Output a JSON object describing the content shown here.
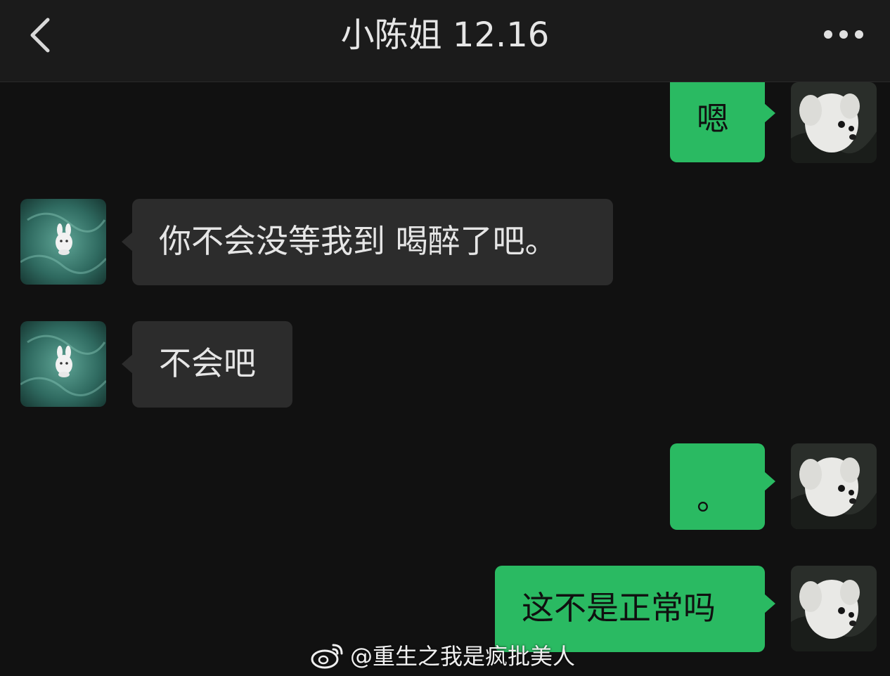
{
  "header": {
    "title": "小陈姐 12.16"
  },
  "icons": {
    "back": "chevron-left-icon",
    "more": "ellipsis-icon",
    "watermark_logo": "weibo-icon"
  },
  "messages": [
    {
      "side": "out",
      "text": "嗯"
    },
    {
      "side": "in",
      "text": "你不会没等我到 喝醉了吧。"
    },
    {
      "side": "in",
      "text": "不会吧"
    },
    {
      "side": "out",
      "text": "。"
    },
    {
      "side": "out",
      "text": "这不是正常吗"
    }
  ],
  "watermark": {
    "text": "@重生之我是疯批美人"
  },
  "colors": {
    "background": "#111111",
    "header": "#1b1b1b",
    "incoming_bubble": "#2c2c2c",
    "outgoing_bubble": "#2aba62",
    "text_light": "#e6e6e6"
  }
}
